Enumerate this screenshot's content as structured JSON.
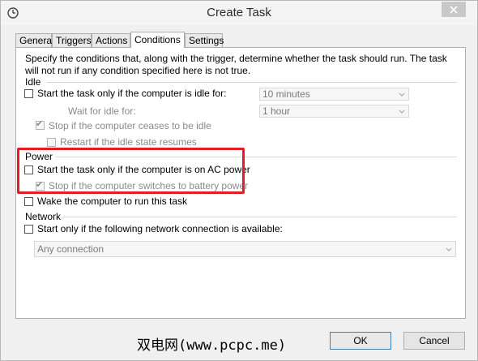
{
  "window": {
    "title": "Create Task"
  },
  "tabs": [
    {
      "label": "General",
      "active": false
    },
    {
      "label": "Triggers",
      "active": false
    },
    {
      "label": "Actions",
      "active": false
    },
    {
      "label": "Conditions",
      "active": true
    },
    {
      "label": "Settings",
      "active": false
    }
  ],
  "conditions": {
    "description": "Specify the conditions that, along with the trigger, determine whether the task should run.  The task will not run  if any condition specified here is not true.",
    "idle": {
      "group_label": "Idle",
      "start_only_idle": {
        "label": "Start the task only if the computer is idle for:",
        "checked": false
      },
      "idle_duration": {
        "value": "10 minutes"
      },
      "wait_label": "Wait for idle for:",
      "wait_duration": {
        "value": "1 hour"
      },
      "stop_if_ceases": {
        "label": "Stop if the computer ceases to be idle",
        "checked": true
      },
      "restart_if_resumes": {
        "label": "Restart if the idle state resumes",
        "checked": false
      }
    },
    "power": {
      "group_label": "Power",
      "start_only_ac": {
        "label": "Start the task only if the computer is on AC power",
        "checked": false
      },
      "stop_on_battery": {
        "label": "Stop if the computer switches to battery power",
        "checked": true
      },
      "wake_to_run": {
        "label": "Wake the computer to run this task",
        "checked": false
      }
    },
    "network": {
      "group_label": "Network",
      "start_only_network": {
        "label": "Start only if the following network connection is available:",
        "checked": false
      },
      "connection": {
        "value": "Any connection"
      }
    }
  },
  "footer": {
    "ok_label": "OK",
    "cancel_label": "Cancel",
    "watermark": "双电网(www.pcpc.me)"
  },
  "colors": {
    "highlight_border": "#e21d24",
    "panel_bg": "#ffffff",
    "window_bg": "#f0f0f0"
  }
}
